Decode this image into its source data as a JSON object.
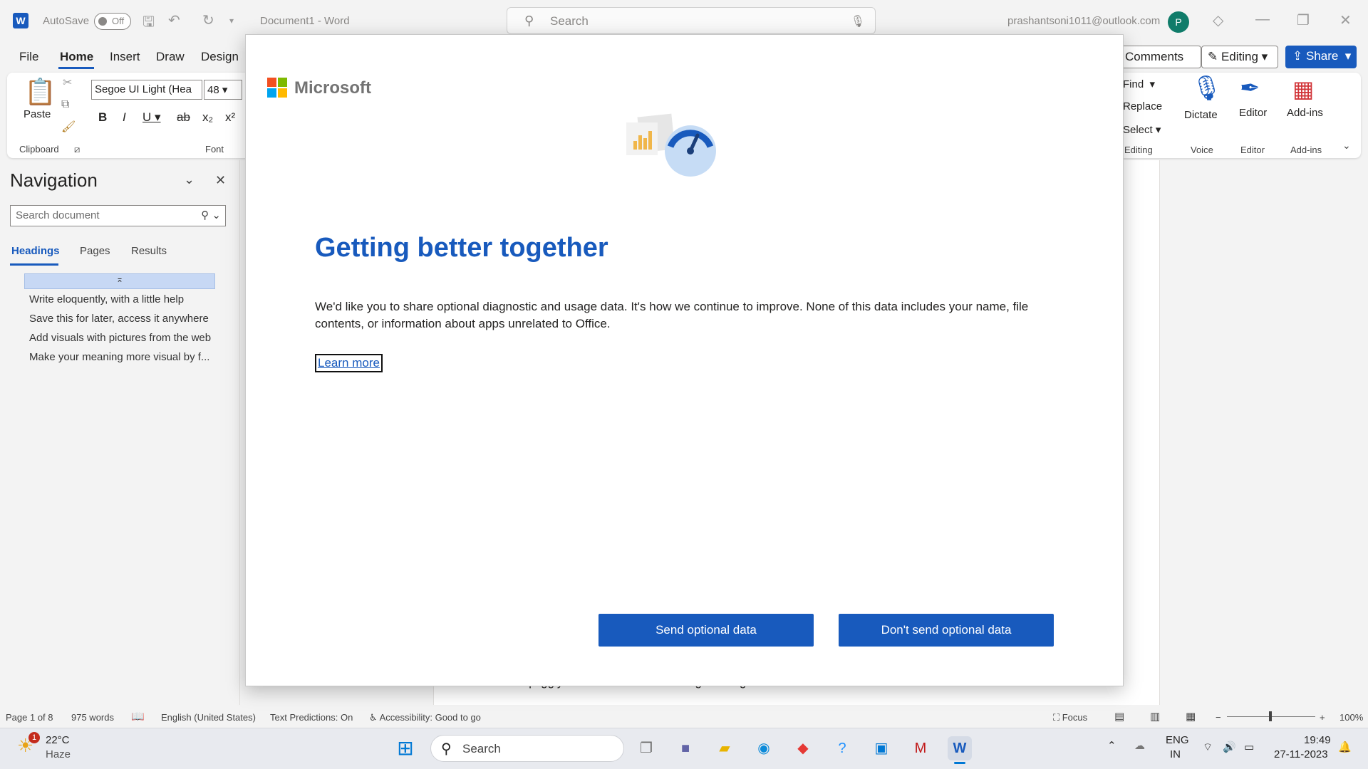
{
  "titlebar": {
    "app_icon": "word-icon",
    "autosave_label": "AutoSave",
    "autosave_state": "Off",
    "doc_title": "Document1  -  Word",
    "search_placeholder": "Search",
    "account_email": "prashantsoni1011@outlook.com",
    "avatar_initial": "P"
  },
  "menu": {
    "tabs": [
      "File",
      "Home",
      "Insert",
      "Draw",
      "Design"
    ],
    "comments": "Comments",
    "editing": "Editing",
    "share": "Share"
  },
  "ribbon": {
    "paste": "Paste",
    "clipboard": "Clipboard",
    "font_name": "Segoe UI Light (Hea",
    "font_size": "48",
    "font_group": "Font",
    "find": "Find",
    "replace": "Replace",
    "select": "Select",
    "editing_group": "Editing",
    "dictate": "Dictate",
    "voice_group": "Voice",
    "editor": "Editor",
    "editor_group": "Editor",
    "addins": "Add-ins",
    "addins_group": "Add-ins"
  },
  "navigation": {
    "title": "Navigation",
    "search_placeholder": "Search document",
    "tabs": [
      "Headings",
      "Pages",
      "Results"
    ],
    "headings": [
      "Write eloquently, with a little help",
      "Save this for later, access it anywhere",
      "Add visuals with pictures from the web",
      "Make your meaning more visual by f..."
    ]
  },
  "document": {
    "peek_text": "squiggly underline. Grammatical glitches get a blue double underline."
  },
  "dialog": {
    "brand": "Microsoft",
    "heading": "Getting better together",
    "body": "We'd like you to share optional diagnostic and usage data. It's how we continue to improve. None of this data includes your name, file contents, or information about apps unrelated to Office.",
    "learn_more": "Learn more",
    "send_button": "Send optional data",
    "dont_send_button": "Don't send optional data"
  },
  "statusbar": {
    "page": "Page 1 of 8",
    "words": "975 words",
    "language": "English (United States)",
    "text_predictions": "Text Predictions: On",
    "accessibility": "Accessibility: Good to go",
    "focus": "Focus",
    "zoom": "100%"
  },
  "taskbar": {
    "weather_temp": "22°C",
    "weather_desc": "Haze",
    "weather_badge": "1",
    "search": "Search",
    "lang_top": "ENG",
    "lang_bottom": "IN",
    "time": "19:49",
    "date": "27-11-2023"
  },
  "colors": {
    "accent": "#185abd",
    "avatar": "#107c6a"
  }
}
